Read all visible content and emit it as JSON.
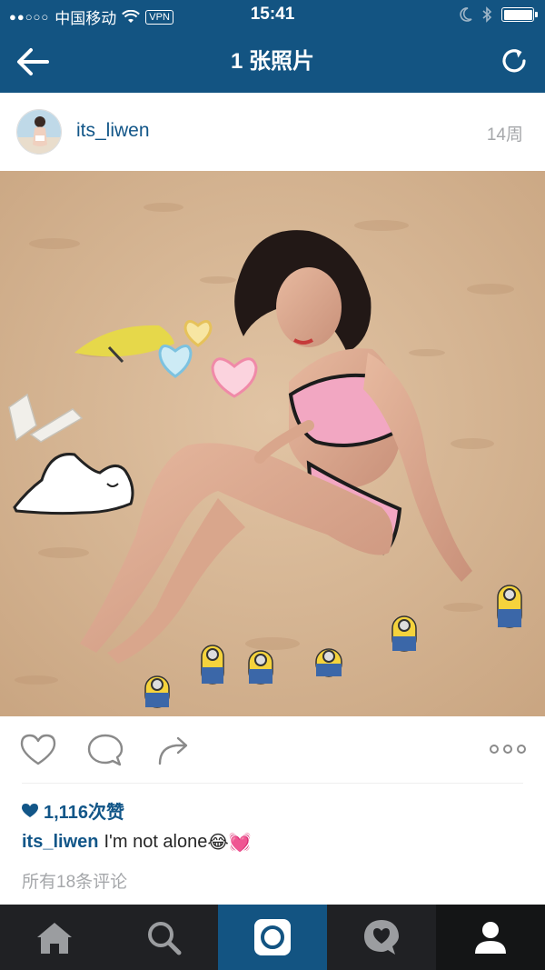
{
  "status_bar": {
    "signal": "●●○○○",
    "carrier": "中国移动",
    "vpn": "VPN",
    "time": "15:41"
  },
  "nav": {
    "title": "1 张照片",
    "back_icon": "arrow-left-icon",
    "refresh_icon": "refresh-icon"
  },
  "post": {
    "username": "its_liwen",
    "time_ago": "14周",
    "likes": "1,116次赞",
    "caption_user": "its_liwen",
    "caption_text": "I'm not alone",
    "caption_emojis": "😂💓",
    "comments_link": "所有18条评论",
    "partial_comment": "· · · · · · · · · · · · · · · · ·"
  },
  "tabs": [
    {
      "name": "home",
      "icon": "home-icon"
    },
    {
      "name": "search",
      "icon": "search-icon"
    },
    {
      "name": "camera",
      "icon": "camera-icon"
    },
    {
      "name": "activity",
      "icon": "heart-bubble-icon"
    },
    {
      "name": "profile",
      "icon": "profile-icon"
    }
  ],
  "colors": {
    "header_bg": "#135482",
    "link": "#125688",
    "tab_bg": "#202124",
    "muted": "#a5a7aa"
  }
}
